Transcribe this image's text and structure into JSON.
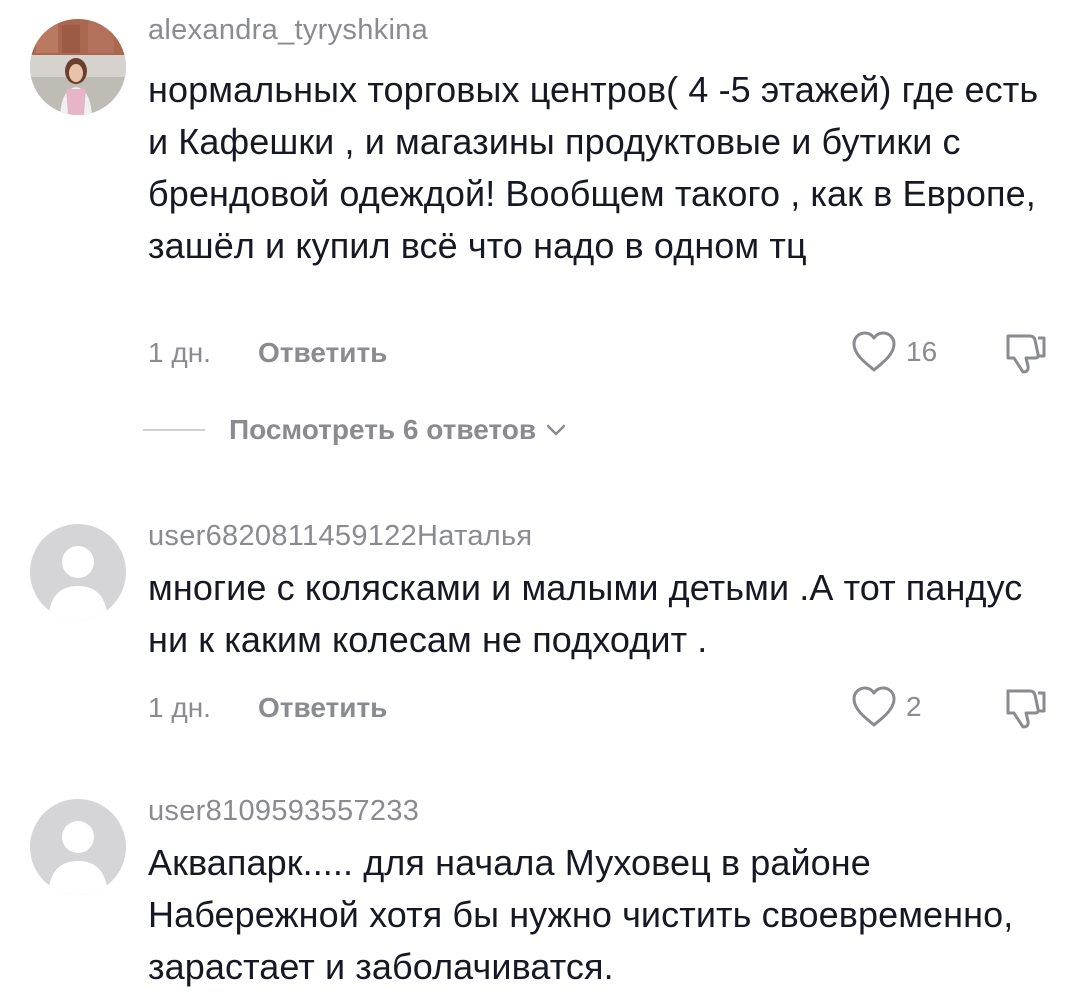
{
  "comments": [
    {
      "username": "alexandra_tyryshkina",
      "text": "нормальных торговых центров( 4 -5 этажей) где есть и Кафешки , и магазины продуктовые и бутики с брендовой одеждой! Вообщем такого , как в Европе, зашёл и купил всё что надо в одном тц",
      "time": "1 дн.",
      "reply_label": "Ответить",
      "likes": "16",
      "view_replies": "Посмотреть 6 ответов"
    },
    {
      "username": "user6820811459122Наталья",
      "text": "многие с колясками и малыми детьми .А тот пандус ни к каким колесам не подходит .",
      "time": "1 дн.",
      "reply_label": "Ответить",
      "likes": "2"
    },
    {
      "username": "user8109593557233",
      "text": "Аквапарк..... для начала Муховец в районе Набережной хотя бы нужно чистить своевременно, зарастает и заболачиватся."
    }
  ],
  "icons": {
    "like": "heart-outline-icon",
    "dislike": "thumbs-down-icon",
    "expand": "chevron-down-icon",
    "avatar_default": "default-user-icon"
  },
  "colors": {
    "primary_text": "#161823",
    "secondary_text": "#8a8b91",
    "avatar_placeholder": "#d5d5d7"
  }
}
